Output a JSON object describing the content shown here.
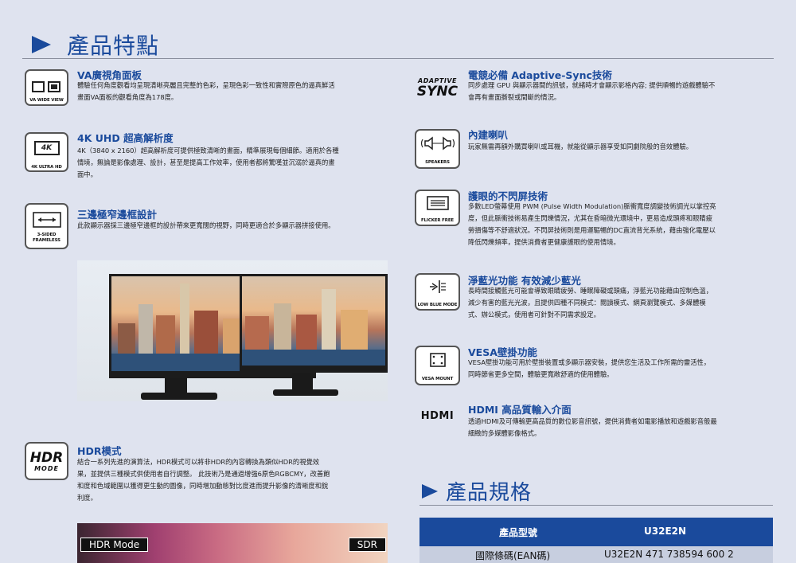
{
  "sections": {
    "features_title": "產品特點",
    "specs_title": "產品規格"
  },
  "features_left": [
    {
      "icon": "va-panel-icon",
      "icon_label": "VA WIDE VIEW",
      "title": "VA廣視角面板",
      "lines": [
        "體驗任何角度觀看均呈現清晰亮麗且完整的色彩，呈現色彩一致性和實際原色的逼真鮮活",
        "畫面VA面板的觀看角度為178度。"
      ]
    },
    {
      "icon": "4k-icon",
      "icon_glyph": "4K",
      "icon_label": "4K ULTRA HD",
      "title": "4K UHD 超高解析度",
      "lines": [
        "4K（3840 x 2160）超高解析度可提供極致清晰的畫面，精準展現每個細節。適用於各種",
        "情境，無論是影像處理、設計，甚至是提高工作效率，使用者都將驚嘆並沉溺於逼真的畫",
        "面中。"
      ]
    },
    {
      "icon": "narrow-border-icon",
      "icon_label": "3-SIDED FRAMELESS",
      "title": "三邊極窄邊框設計",
      "lines": [
        "此款顯示器採三邊極窄邊框的設計帶來更寬闊的視野，同時更適合於多顯示器拼接使用。"
      ]
    },
    {
      "icon": "hdr-mode-icon",
      "icon_glyph": "HDR",
      "icon_label": "MODE",
      "title": "HDR模式",
      "lines": [
        "結合一系列先進的演算法，HDR模式可以將非HDR的內容轉換為類似HDR的視覺效",
        "果，並提供三種模式供使用者自行調整。 此技術乃是通過增強6原色RGBCMY，改善飽",
        "和度和色域範圍以獲得更生動的圖像，同時增加動態對比度進而提升影像的清晰度和銳",
        "利度。"
      ]
    }
  ],
  "features_right": [
    {
      "icon": "adaptive-sync-icon",
      "icon_label": "ADAPTIVE SYNC",
      "title": "電競必備 Adaptive-Sync技術",
      "lines": [
        "同步處理 GPU 與顯示器間的訊號，就緒時才會顯示影格內容; 提供順暢的遊戲體驗不",
        "會再有畫面撕裂或間斷的情況。"
      ]
    },
    {
      "icon": "speakers-icon",
      "icon_label": "SPEAKERS",
      "title": "內建喇叭",
      "lines": [
        "玩家無需再額外購買喇叭或耳機，就能從顯示器享受如同劇院般的音效體驗。"
      ]
    },
    {
      "icon": "flicker-free-icon",
      "icon_label": "FLICKER FREE",
      "title": "護眼的不閃屏技術",
      "lines": [
        "多數LED螢幕使用 PWM (Pulse Width Modulation)脈衝寬度調變技術調光以掌控亮",
        "度，但此脈衝技術易產生閃爍情況，尤其在昏暗微光環境中，更易造成頭疼和眼睛疲",
        "勞損傷等不舒適狀況。不閃屏技術則是用運驅暢的DC直流背光系統，藉由強化電壓以",
        "降低閃爍頻率，提供消費者更健康護眼的使用情境。"
      ]
    },
    {
      "icon": "low-blue-mode-icon",
      "icon_label": "LOW BLUE MODE",
      "title": "淨藍光功能 有效減少藍光",
      "lines": [
        "長時間接觸藍光可能會導致眼睛疲勞、睡眠障礙或頭痛，淨藍光功能藉由控制色溫，",
        "減少有害的藍光光波，且提供四種不同模式：閱讀模式、網頁瀏覽模式、多媒體模",
        "式、辦公模式，使用者可針對不同需求設定。"
      ]
    },
    {
      "icon": "vesa-mount-icon",
      "icon_label": "VESA MOUNT",
      "title": "VESA壁掛功能",
      "lines": [
        "VESA壁掛功能可用於壁掛裝置或多顯示器安裝，提供您生活及工作所需的靈活性，",
        "同時節省更多空間，體驗更寬敞舒適的使用體驗。"
      ]
    },
    {
      "icon": "hdmi-icon",
      "icon_label": "HDMI",
      "title": "HDMI 高品質輸入介面",
      "lines": [
        "透過HDMI及可傳輸更高品質的數位影音訊號，提供消費者如電影播放和遊戲影音般最",
        "細緻的多媒體影像格式。"
      ]
    }
  ],
  "hdr_banner": {
    "left_tag": "HDR Mode",
    "right_tag": "SDR"
  },
  "spec_table": {
    "header": [
      "產品型號",
      "U32E2N"
    ],
    "rows": [
      [
        "國際條碼(EAN碼)",
        "U32E2N 471 738594 600 2"
      ]
    ]
  },
  "colors": {
    "accent": "#1a4a9c",
    "background": "#dfe3ef",
    "table_header": "#1a4a9c",
    "table_row": "#c7cedf"
  }
}
